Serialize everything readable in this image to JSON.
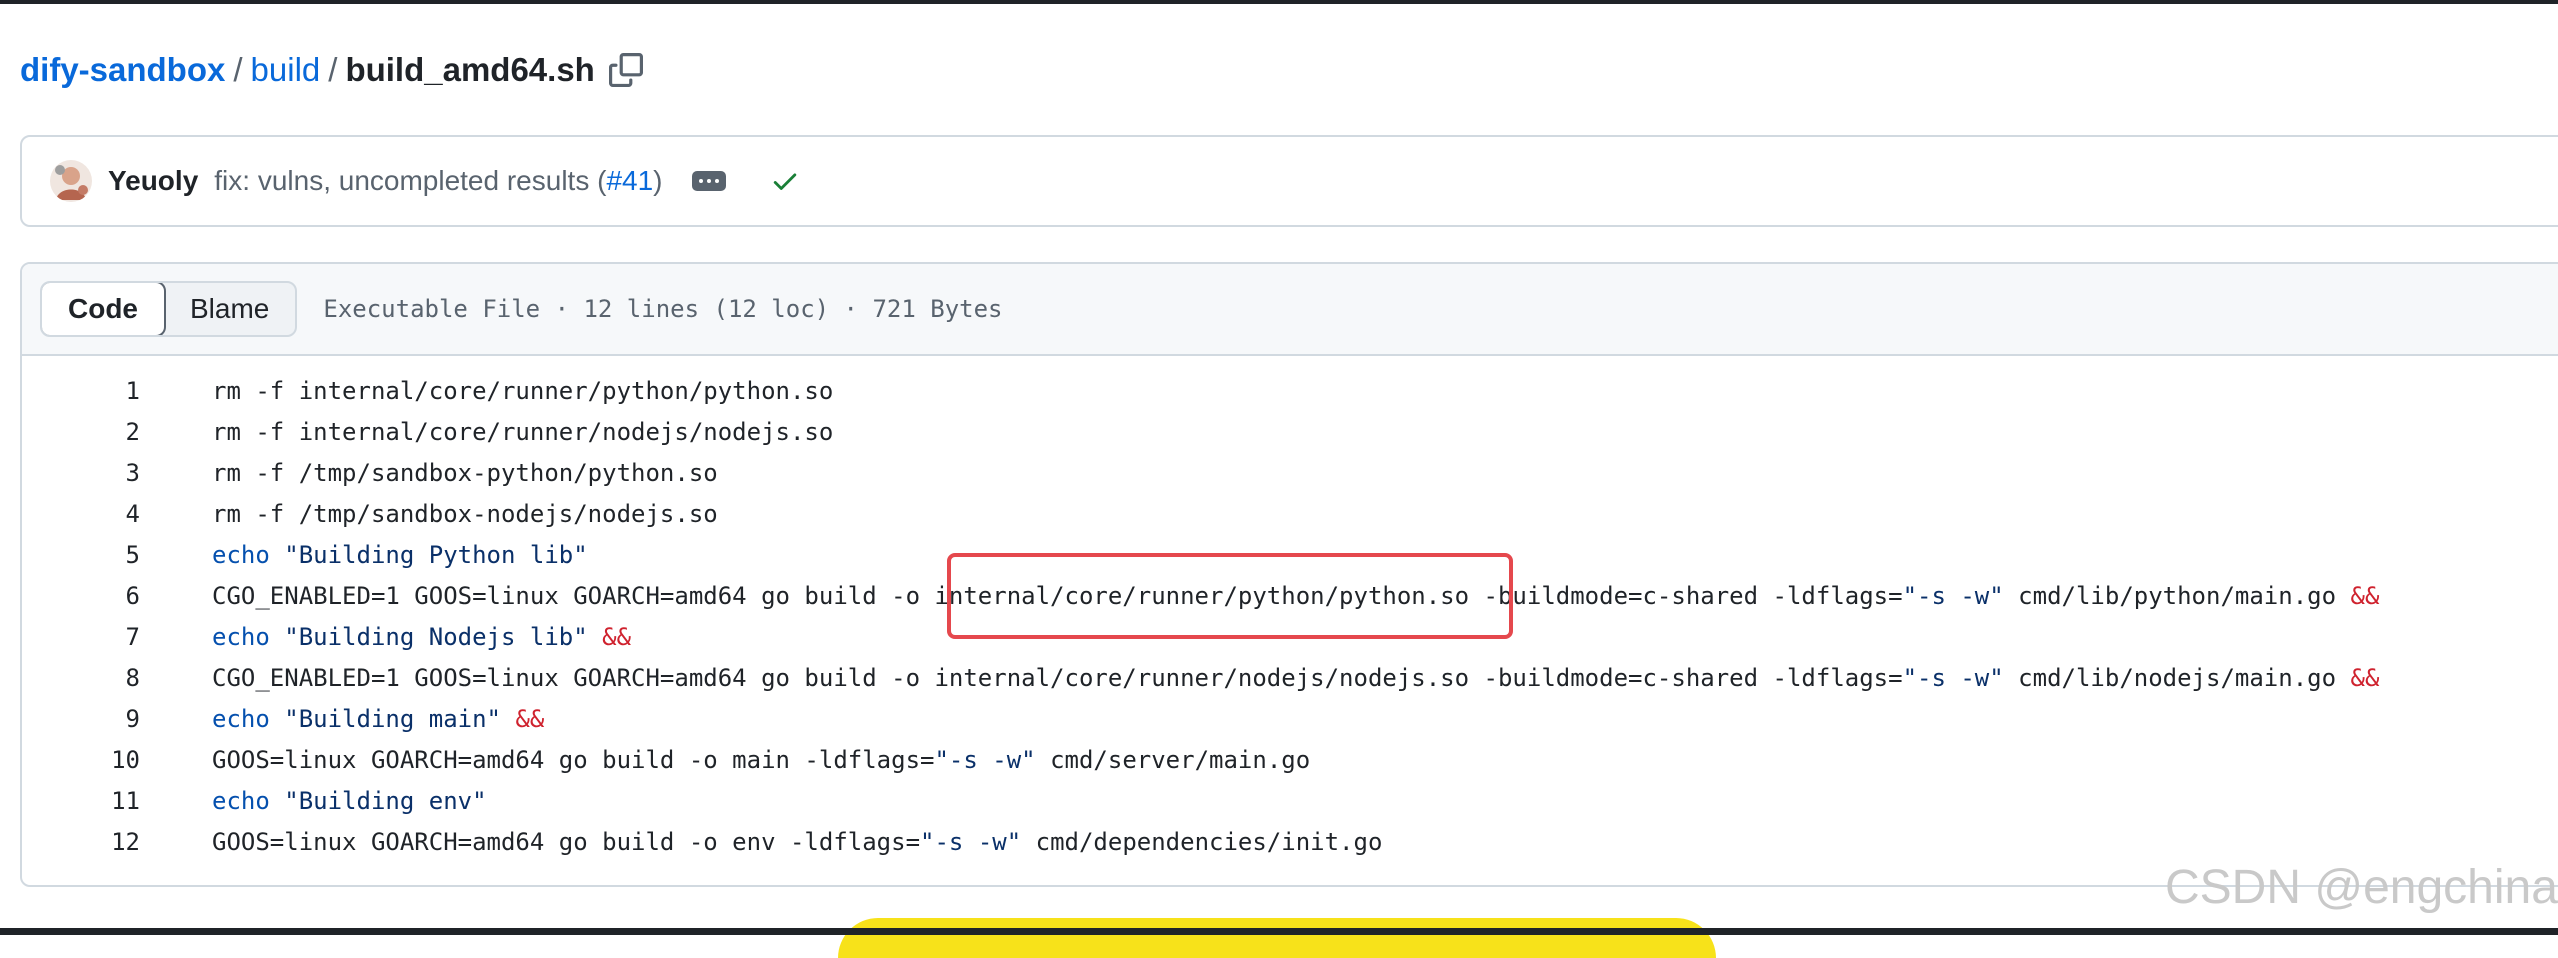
{
  "breadcrumb": {
    "repo": "dify-sandbox",
    "sep1": "/",
    "folder": "build",
    "sep2": "/",
    "file": "build_amd64.sh"
  },
  "commit": {
    "author": "Yeuoly",
    "message": "fix: vulns, uncompleted results (",
    "pr_link": "#41",
    "message_end": ")",
    "status_icon": "check-icon",
    "status_color": "#1a7f37"
  },
  "file": {
    "tabs": [
      {
        "label": "Code",
        "active": true
      },
      {
        "label": "Blame",
        "active": false
      }
    ],
    "meta": "Executable File · 12 lines (12 loc) · 721 Bytes"
  },
  "code": {
    "lines": [
      {
        "n": "1",
        "segments": [
          {
            "t": "rm -f internal/core/runner/python/python.so",
            "c": ""
          }
        ]
      },
      {
        "n": "2",
        "segments": [
          {
            "t": "rm -f internal/core/runner/nodejs/nodejs.so",
            "c": ""
          }
        ]
      },
      {
        "n": "3",
        "segments": [
          {
            "t": "rm -f /tmp/sandbox-python/python.so",
            "c": ""
          }
        ]
      },
      {
        "n": "4",
        "segments": [
          {
            "t": "rm -f /tmp/sandbox-nodejs/nodejs.so",
            "c": ""
          }
        ]
      },
      {
        "n": "5",
        "segments": [
          {
            "t": "echo",
            "c": "kw"
          },
          {
            "t": " ",
            "c": ""
          },
          {
            "t": "\"Building Python lib\"",
            "c": "str"
          }
        ]
      },
      {
        "n": "6",
        "segments": [
          {
            "t": "CGO_ENABLED=1 GOOS=linux GOARCH=amd64 go build -o internal/core/runner/python/python.so -buildmode=c-shared -ldflags=",
            "c": ""
          },
          {
            "t": "\"-s -w\"",
            "c": "str"
          },
          {
            "t": " cmd/lib/python/main.go ",
            "c": ""
          },
          {
            "t": "&&",
            "c": "op"
          }
        ]
      },
      {
        "n": "7",
        "segments": [
          {
            "t": "echo",
            "c": "kw"
          },
          {
            "t": " ",
            "c": ""
          },
          {
            "t": "\"Building Nodejs lib\"",
            "c": "str"
          },
          {
            "t": " ",
            "c": ""
          },
          {
            "t": "&&",
            "c": "op"
          }
        ]
      },
      {
        "n": "8",
        "segments": [
          {
            "t": "CGO_ENABLED=1 GOOS=linux GOARCH=amd64 go build -o internal/core/runner/nodejs/nodejs.so -buildmode=c-shared -ldflags=",
            "c": ""
          },
          {
            "t": "\"-s -w\"",
            "c": "str"
          },
          {
            "t": " cmd/lib/nodejs/main.go ",
            "c": ""
          },
          {
            "t": "&&",
            "c": "op"
          }
        ]
      },
      {
        "n": "9",
        "segments": [
          {
            "t": "echo",
            "c": "kw"
          },
          {
            "t": " ",
            "c": ""
          },
          {
            "t": "\"Building main\"",
            "c": "str"
          },
          {
            "t": " ",
            "c": ""
          },
          {
            "t": "&&",
            "c": "op"
          }
        ]
      },
      {
        "n": "10",
        "segments": [
          {
            "t": "GOOS=linux GOARCH=amd64 go build -o main -ldflags=",
            "c": ""
          },
          {
            "t": "\"-s -w\"",
            "c": "str"
          },
          {
            "t": " cmd/server/main.go",
            "c": ""
          }
        ]
      },
      {
        "n": "11",
        "segments": [
          {
            "t": "echo",
            "c": "kw"
          },
          {
            "t": " ",
            "c": ""
          },
          {
            "t": "\"Building env\"",
            "c": "str"
          }
        ]
      },
      {
        "n": "12",
        "segments": [
          {
            "t": "GOOS=linux GOARCH=amd64 go build -o env -ldflags=",
            "c": ""
          },
          {
            "t": "\"-s -w\"",
            "c": "str"
          },
          {
            "t": " cmd/dependencies/init.go",
            "c": ""
          }
        ]
      }
    ]
  },
  "watermark": "CSDN @engchina",
  "colors": {
    "link": "#0969da",
    "highlight_border": "#e5484d",
    "keyword": "#0550ae",
    "string": "#0a3069",
    "operator": "#cf222e"
  }
}
